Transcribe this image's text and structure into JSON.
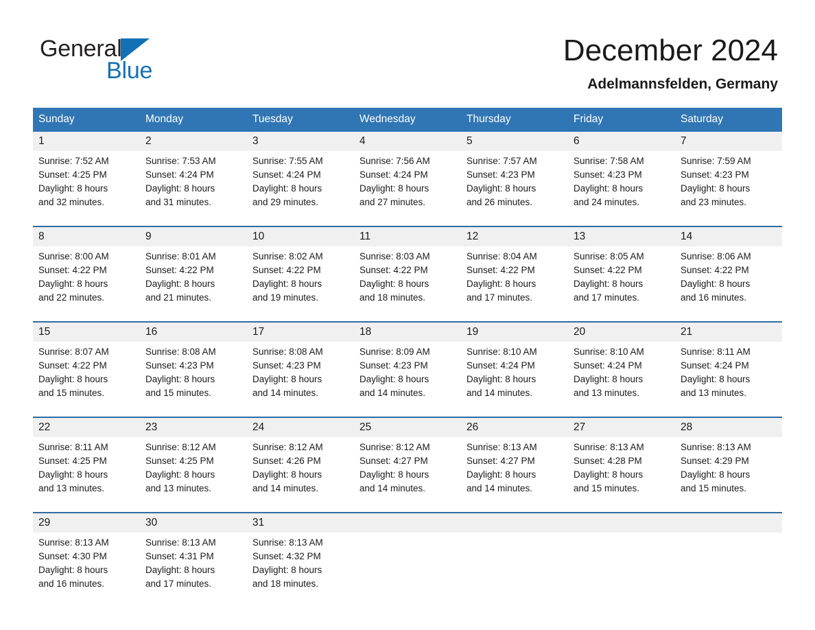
{
  "logo": {
    "word1": "General",
    "word2": "Blue",
    "triangle_color": "#1271b5",
    "text_color": "#231f20"
  },
  "header": {
    "month_title": "December 2024",
    "location": "Adelmannsfelden, Germany"
  },
  "theme": {
    "header_blue": "#3076b4",
    "rule_blue": "#2e6da4",
    "daynum_band": "#f0f0f0"
  },
  "calendar": {
    "weekday_headers": [
      "Sunday",
      "Monday",
      "Tuesday",
      "Wednesday",
      "Thursday",
      "Friday",
      "Saturday"
    ],
    "weeks": [
      [
        {
          "day": "1",
          "sunrise": "Sunrise: 7:52 AM",
          "sunset": "Sunset: 4:25 PM",
          "daylight1": "Daylight: 8 hours",
          "daylight2": "and 32 minutes."
        },
        {
          "day": "2",
          "sunrise": "Sunrise: 7:53 AM",
          "sunset": "Sunset: 4:24 PM",
          "daylight1": "Daylight: 8 hours",
          "daylight2": "and 31 minutes."
        },
        {
          "day": "3",
          "sunrise": "Sunrise: 7:55 AM",
          "sunset": "Sunset: 4:24 PM",
          "daylight1": "Daylight: 8 hours",
          "daylight2": "and 29 minutes."
        },
        {
          "day": "4",
          "sunrise": "Sunrise: 7:56 AM",
          "sunset": "Sunset: 4:24 PM",
          "daylight1": "Daylight: 8 hours",
          "daylight2": "and 27 minutes."
        },
        {
          "day": "5",
          "sunrise": "Sunrise: 7:57 AM",
          "sunset": "Sunset: 4:23 PM",
          "daylight1": "Daylight: 8 hours",
          "daylight2": "and 26 minutes."
        },
        {
          "day": "6",
          "sunrise": "Sunrise: 7:58 AM",
          "sunset": "Sunset: 4:23 PM",
          "daylight1": "Daylight: 8 hours",
          "daylight2": "and 24 minutes."
        },
        {
          "day": "7",
          "sunrise": "Sunrise: 7:59 AM",
          "sunset": "Sunset: 4:23 PM",
          "daylight1": "Daylight: 8 hours",
          "daylight2": "and 23 minutes."
        }
      ],
      [
        {
          "day": "8",
          "sunrise": "Sunrise: 8:00 AM",
          "sunset": "Sunset: 4:22 PM",
          "daylight1": "Daylight: 8 hours",
          "daylight2": "and 22 minutes."
        },
        {
          "day": "9",
          "sunrise": "Sunrise: 8:01 AM",
          "sunset": "Sunset: 4:22 PM",
          "daylight1": "Daylight: 8 hours",
          "daylight2": "and 21 minutes."
        },
        {
          "day": "10",
          "sunrise": "Sunrise: 8:02 AM",
          "sunset": "Sunset: 4:22 PM",
          "daylight1": "Daylight: 8 hours",
          "daylight2": "and 19 minutes."
        },
        {
          "day": "11",
          "sunrise": "Sunrise: 8:03 AM",
          "sunset": "Sunset: 4:22 PM",
          "daylight1": "Daylight: 8 hours",
          "daylight2": "and 18 minutes."
        },
        {
          "day": "12",
          "sunrise": "Sunrise: 8:04 AM",
          "sunset": "Sunset: 4:22 PM",
          "daylight1": "Daylight: 8 hours",
          "daylight2": "and 17 minutes."
        },
        {
          "day": "13",
          "sunrise": "Sunrise: 8:05 AM",
          "sunset": "Sunset: 4:22 PM",
          "daylight1": "Daylight: 8 hours",
          "daylight2": "and 17 minutes."
        },
        {
          "day": "14",
          "sunrise": "Sunrise: 8:06 AM",
          "sunset": "Sunset: 4:22 PM",
          "daylight1": "Daylight: 8 hours",
          "daylight2": "and 16 minutes."
        }
      ],
      [
        {
          "day": "15",
          "sunrise": "Sunrise: 8:07 AM",
          "sunset": "Sunset: 4:22 PM",
          "daylight1": "Daylight: 8 hours",
          "daylight2": "and 15 minutes."
        },
        {
          "day": "16",
          "sunrise": "Sunrise: 8:08 AM",
          "sunset": "Sunset: 4:23 PM",
          "daylight1": "Daylight: 8 hours",
          "daylight2": "and 15 minutes."
        },
        {
          "day": "17",
          "sunrise": "Sunrise: 8:08 AM",
          "sunset": "Sunset: 4:23 PM",
          "daylight1": "Daylight: 8 hours",
          "daylight2": "and 14 minutes."
        },
        {
          "day": "18",
          "sunrise": "Sunrise: 8:09 AM",
          "sunset": "Sunset: 4:23 PM",
          "daylight1": "Daylight: 8 hours",
          "daylight2": "and 14 minutes."
        },
        {
          "day": "19",
          "sunrise": "Sunrise: 8:10 AM",
          "sunset": "Sunset: 4:24 PM",
          "daylight1": "Daylight: 8 hours",
          "daylight2": "and 14 minutes."
        },
        {
          "day": "20",
          "sunrise": "Sunrise: 8:10 AM",
          "sunset": "Sunset: 4:24 PM",
          "daylight1": "Daylight: 8 hours",
          "daylight2": "and 13 minutes."
        },
        {
          "day": "21",
          "sunrise": "Sunrise: 8:11 AM",
          "sunset": "Sunset: 4:24 PM",
          "daylight1": "Daylight: 8 hours",
          "daylight2": "and 13 minutes."
        }
      ],
      [
        {
          "day": "22",
          "sunrise": "Sunrise: 8:11 AM",
          "sunset": "Sunset: 4:25 PM",
          "daylight1": "Daylight: 8 hours",
          "daylight2": "and 13 minutes."
        },
        {
          "day": "23",
          "sunrise": "Sunrise: 8:12 AM",
          "sunset": "Sunset: 4:25 PM",
          "daylight1": "Daylight: 8 hours",
          "daylight2": "and 13 minutes."
        },
        {
          "day": "24",
          "sunrise": "Sunrise: 8:12 AM",
          "sunset": "Sunset: 4:26 PM",
          "daylight1": "Daylight: 8 hours",
          "daylight2": "and 14 minutes."
        },
        {
          "day": "25",
          "sunrise": "Sunrise: 8:12 AM",
          "sunset": "Sunset: 4:27 PM",
          "daylight1": "Daylight: 8 hours",
          "daylight2": "and 14 minutes."
        },
        {
          "day": "26",
          "sunrise": "Sunrise: 8:13 AM",
          "sunset": "Sunset: 4:27 PM",
          "daylight1": "Daylight: 8 hours",
          "daylight2": "and 14 minutes."
        },
        {
          "day": "27",
          "sunrise": "Sunrise: 8:13 AM",
          "sunset": "Sunset: 4:28 PM",
          "daylight1": "Daylight: 8 hours",
          "daylight2": "and 15 minutes."
        },
        {
          "day": "28",
          "sunrise": "Sunrise: 8:13 AM",
          "sunset": "Sunset: 4:29 PM",
          "daylight1": "Daylight: 8 hours",
          "daylight2": "and 15 minutes."
        }
      ],
      [
        {
          "day": "29",
          "sunrise": "Sunrise: 8:13 AM",
          "sunset": "Sunset: 4:30 PM",
          "daylight1": "Daylight: 8 hours",
          "daylight2": "and 16 minutes."
        },
        {
          "day": "30",
          "sunrise": "Sunrise: 8:13 AM",
          "sunset": "Sunset: 4:31 PM",
          "daylight1": "Daylight: 8 hours",
          "daylight2": "and 17 minutes."
        },
        {
          "day": "31",
          "sunrise": "Sunrise: 8:13 AM",
          "sunset": "Sunset: 4:32 PM",
          "daylight1": "Daylight: 8 hours",
          "daylight2": "and 18 minutes."
        },
        {
          "day": "",
          "sunrise": "",
          "sunset": "",
          "daylight1": "",
          "daylight2": ""
        },
        {
          "day": "",
          "sunrise": "",
          "sunset": "",
          "daylight1": "",
          "daylight2": ""
        },
        {
          "day": "",
          "sunrise": "",
          "sunset": "",
          "daylight1": "",
          "daylight2": ""
        },
        {
          "day": "",
          "sunrise": "",
          "sunset": "",
          "daylight1": "",
          "daylight2": ""
        }
      ]
    ]
  }
}
